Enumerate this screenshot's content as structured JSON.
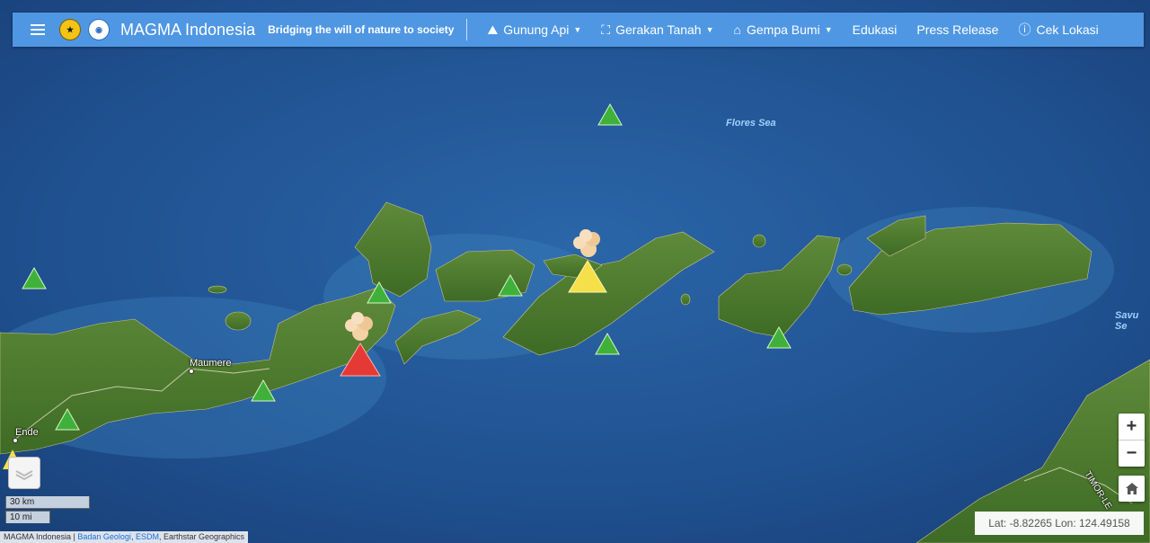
{
  "navbar": {
    "brand": "MAGMA Indonesia",
    "tagline": "Bridging the will of nature to society",
    "items": [
      {
        "label": "Gunung Api",
        "icon": "volcano-icon",
        "dropdown": true
      },
      {
        "label": "Gerakan Tanah",
        "icon": "landslide-icon",
        "dropdown": true
      },
      {
        "label": "Gempa Bumi",
        "icon": "earthquake-icon",
        "dropdown": true
      },
      {
        "label": "Edukasi",
        "dropdown": false
      },
      {
        "label": "Press Release",
        "dropdown": false
      },
      {
        "label": "Cek Lokasi",
        "icon": "info-icon",
        "dropdown": false
      }
    ]
  },
  "map": {
    "places": [
      "Maumere",
      "Ende"
    ],
    "seas": [
      "Flores Sea",
      "Savu Se"
    ],
    "region_label": "TIMOR-LE"
  },
  "scale": {
    "km": "30 km",
    "mi": "10 mi"
  },
  "coords": "Lat: -8.82265 Lon: 124.49158",
  "attribution": {
    "prefix": "MAGMA Indonesia | ",
    "link1": "Badan Geologi",
    "sep": ", ",
    "link2": "ESDM",
    "suffix": ", Earthstar Geographics"
  },
  "zoom": {
    "in": "+",
    "out": "−"
  },
  "volcano_status_colors": {
    "normal": "#3fb13b",
    "advisory": "#f5e04a",
    "warning": "#e53935"
  }
}
